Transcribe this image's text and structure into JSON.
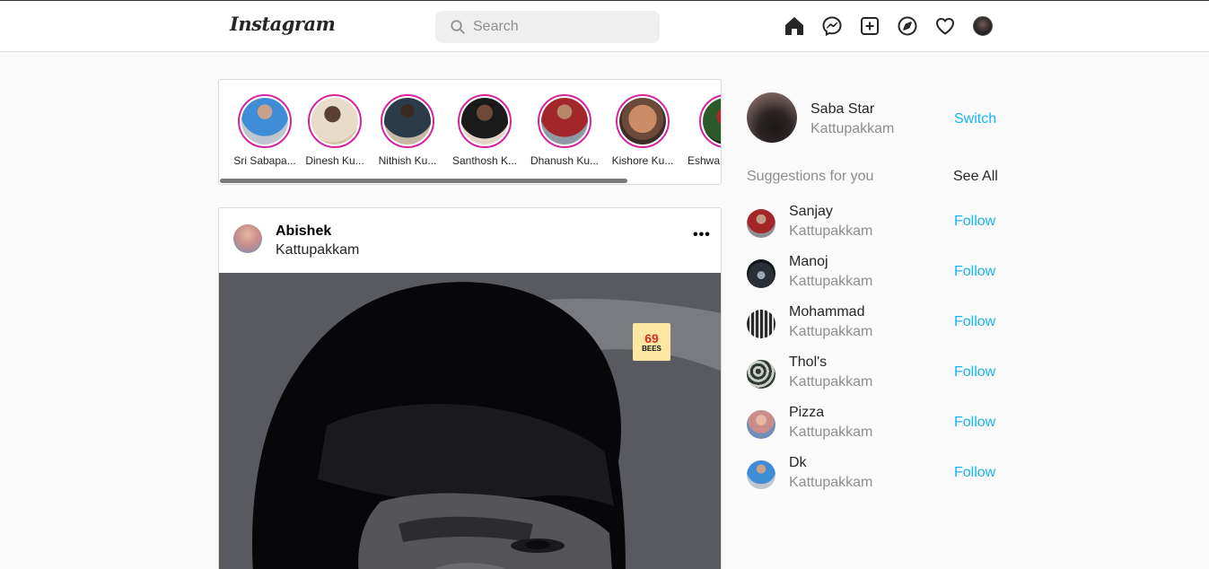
{
  "header": {
    "logo": "Instagram",
    "search_placeholder": "Search",
    "icons": [
      "home-icon",
      "messenger-icon",
      "new-post-icon",
      "explore-icon",
      "activity-heart-icon",
      "profile-avatar"
    ]
  },
  "stories": [
    {
      "name": "Sri Sabapa..."
    },
    {
      "name": "Dinesh Ku..."
    },
    {
      "name": "Nithish Ku..."
    },
    {
      "name": "Santhosh K..."
    },
    {
      "name": "Dhanush Ku..."
    },
    {
      "name": "Kishore Ku..."
    },
    {
      "name": "Eshwa"
    }
  ],
  "post": {
    "username": "Abishek",
    "location": "Kattupakkam",
    "more": "•••",
    "badge_top": "69",
    "badge_bottom": "BEES"
  },
  "profile": {
    "name": "Saba Star",
    "location": "Kattupakkam",
    "switch_label": "Switch"
  },
  "suggestions": {
    "title": "Suggestions for you",
    "see_all": "See All",
    "items": [
      {
        "name": "Sanjay",
        "location": "Kattupakkam",
        "action": "Follow"
      },
      {
        "name": "Manoj",
        "location": "Kattupakkam",
        "action": "Follow"
      },
      {
        "name": "Mohammad",
        "location": "Kattupakkam",
        "action": "Follow"
      },
      {
        "name": "Thol's",
        "location": "Kattupakkam",
        "action": "Follow"
      },
      {
        "name": "Pizza",
        "location": "Kattupakkam",
        "action": "Follow"
      },
      {
        "name": "Dk",
        "location": "Kattupakkam",
        "action": "Follow"
      }
    ]
  },
  "colors": {
    "accent": "#14b5f1",
    "story_ring": "#d6249f",
    "background": "#fafafa"
  }
}
